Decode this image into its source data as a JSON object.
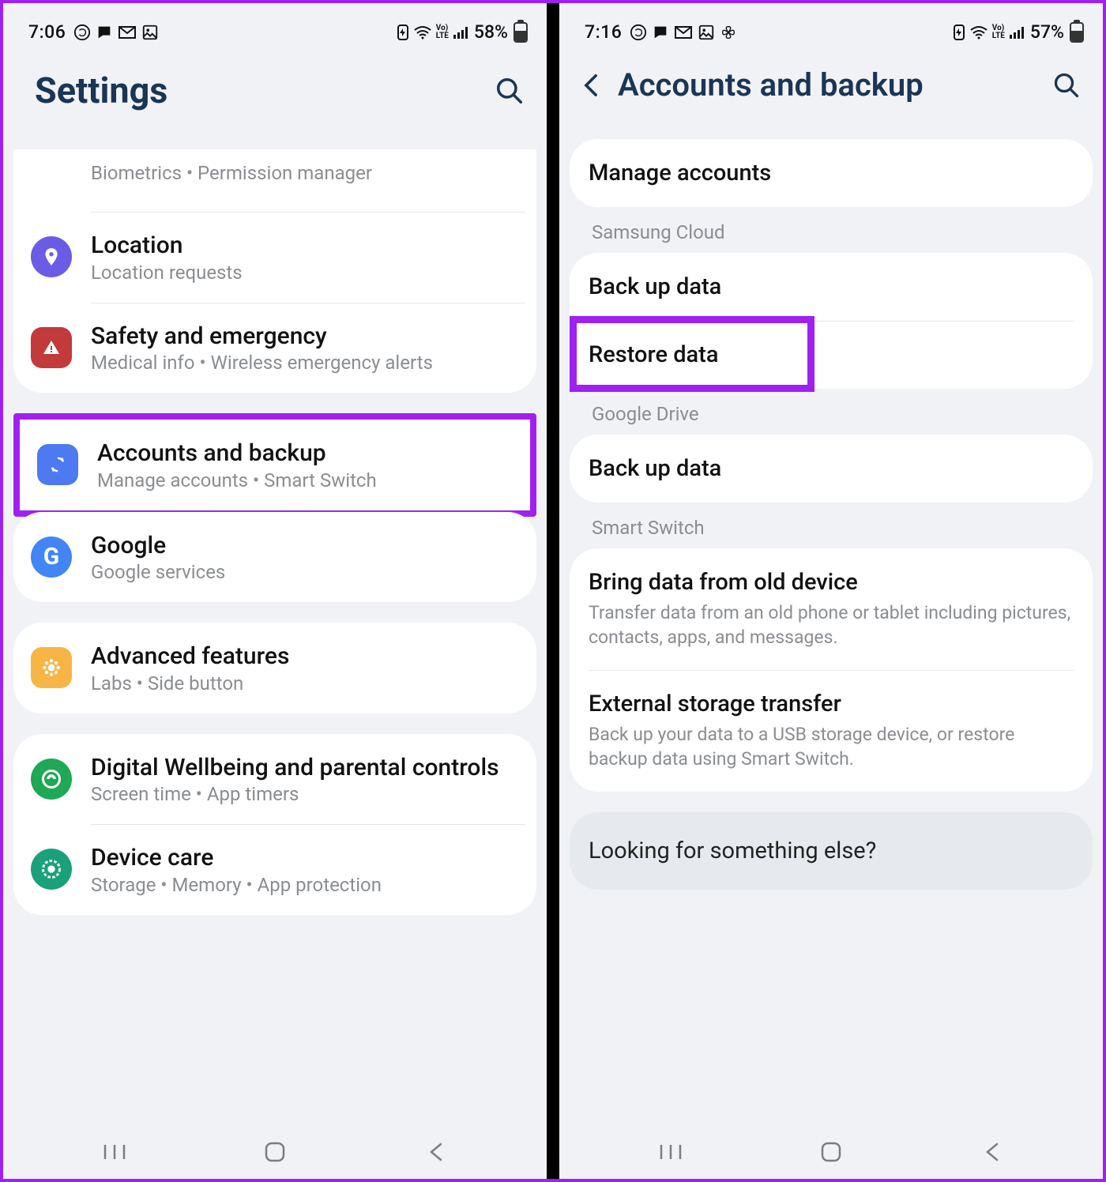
{
  "left": {
    "status": {
      "time": "7:06",
      "battery": "58%",
      "battery_fill": "58"
    },
    "header": {
      "title": "Settings"
    },
    "rows": [
      {
        "title": "",
        "sub": "Biometrics  •  Permission manager",
        "partial": true
      },
      {
        "title": "Location",
        "sub": "Location requests",
        "color": "ic-purple",
        "icon": "location-icon"
      },
      {
        "title": "Safety and emergency",
        "sub": "Medical info  •  Wireless emergency alerts",
        "color": "ic-red",
        "icon": "alert-icon"
      },
      {
        "title": "Accounts and backup",
        "sub": "Manage accounts  •  Smart Switch",
        "color": "ic-blue",
        "icon": "sync-icon",
        "highlight": true
      },
      {
        "title": "Google",
        "sub": "Google services",
        "color": "ic-google",
        "icon": "google-icon"
      },
      {
        "title": "Advanced features",
        "sub": "Labs  •  Side button",
        "color": "ic-yellow",
        "icon": "gear-flower-icon"
      },
      {
        "title": "Digital Wellbeing and parental controls",
        "sub": "Screen time  •  App timers",
        "color": "ic-green",
        "icon": "wellbeing-icon"
      },
      {
        "title": "Device care",
        "sub": "Storage  •  Memory  •  App protection",
        "color": "ic-teal",
        "icon": "device-care-icon"
      }
    ]
  },
  "right": {
    "status": {
      "time": "7:16",
      "battery": "57%",
      "battery_fill": "57"
    },
    "header": {
      "title": "Accounts and backup"
    },
    "sections": {
      "manage": "Manage accounts",
      "samsung_cloud_header": "Samsung Cloud",
      "samsung_backup": "Back up data",
      "samsung_restore": "Restore data",
      "google_drive_header": "Google Drive",
      "google_backup": "Back up data",
      "smart_switch_header": "Smart Switch",
      "bring_title": "Bring data from old device",
      "bring_sub": "Transfer data from an old phone or tablet including pictures, contacts, apps, and messages.",
      "ext_title": "External storage transfer",
      "ext_sub": "Back up your data to a USB storage device, or restore backup data using Smart Switch.",
      "looking": "Looking for something else?"
    }
  }
}
